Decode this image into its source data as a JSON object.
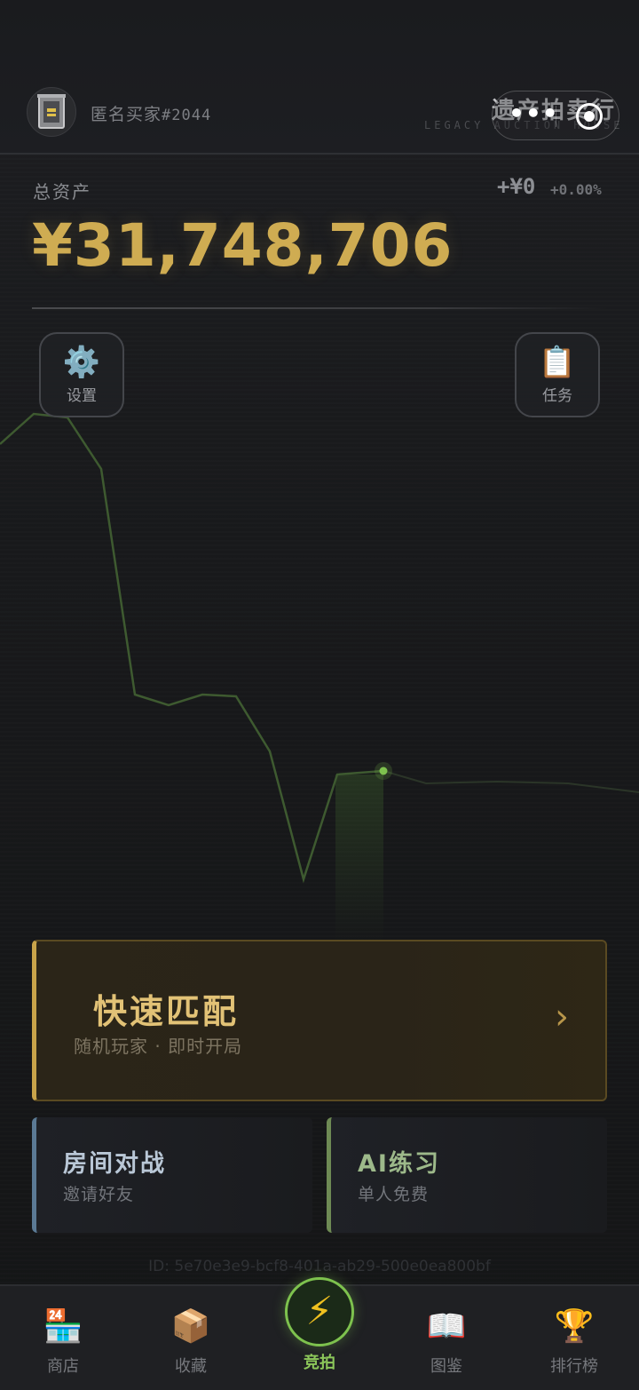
{
  "header": {
    "username": "匿名买家",
    "user_tag": "#2044",
    "brand_title": "遗产拍卖行",
    "brand_subtitle": "LEGACY AUCTION HOUSE"
  },
  "assets": {
    "label": "总资产",
    "total": "¥31,748,706",
    "change_abs": "+¥0",
    "change_pct": "+0.00%"
  },
  "side_buttons": {
    "settings_label": "设置",
    "settings_icon": "gear-icon",
    "tasks_label": "任务",
    "tasks_icon": "clipboard-icon"
  },
  "modes": {
    "quick_title": "快速匹配",
    "quick_sub": "随机玩家 · 即时开局",
    "room_title": "房间对战",
    "room_sub": "邀请好友",
    "ai_title": "AI练习",
    "ai_sub": "单人免费"
  },
  "device_id": "ID: 5e70e3e9-bcf8-401a-ab29-500e0ea800bf",
  "nav": {
    "shop": "商店",
    "collect": "收藏",
    "auction": "竞拍",
    "codex": "图鉴",
    "rank": "排行榜"
  },
  "colors": {
    "gold": "#cfac52",
    "green": "#7ec24e",
    "room_accent": "#5b7a95",
    "ai_accent": "#6e8a54"
  }
}
